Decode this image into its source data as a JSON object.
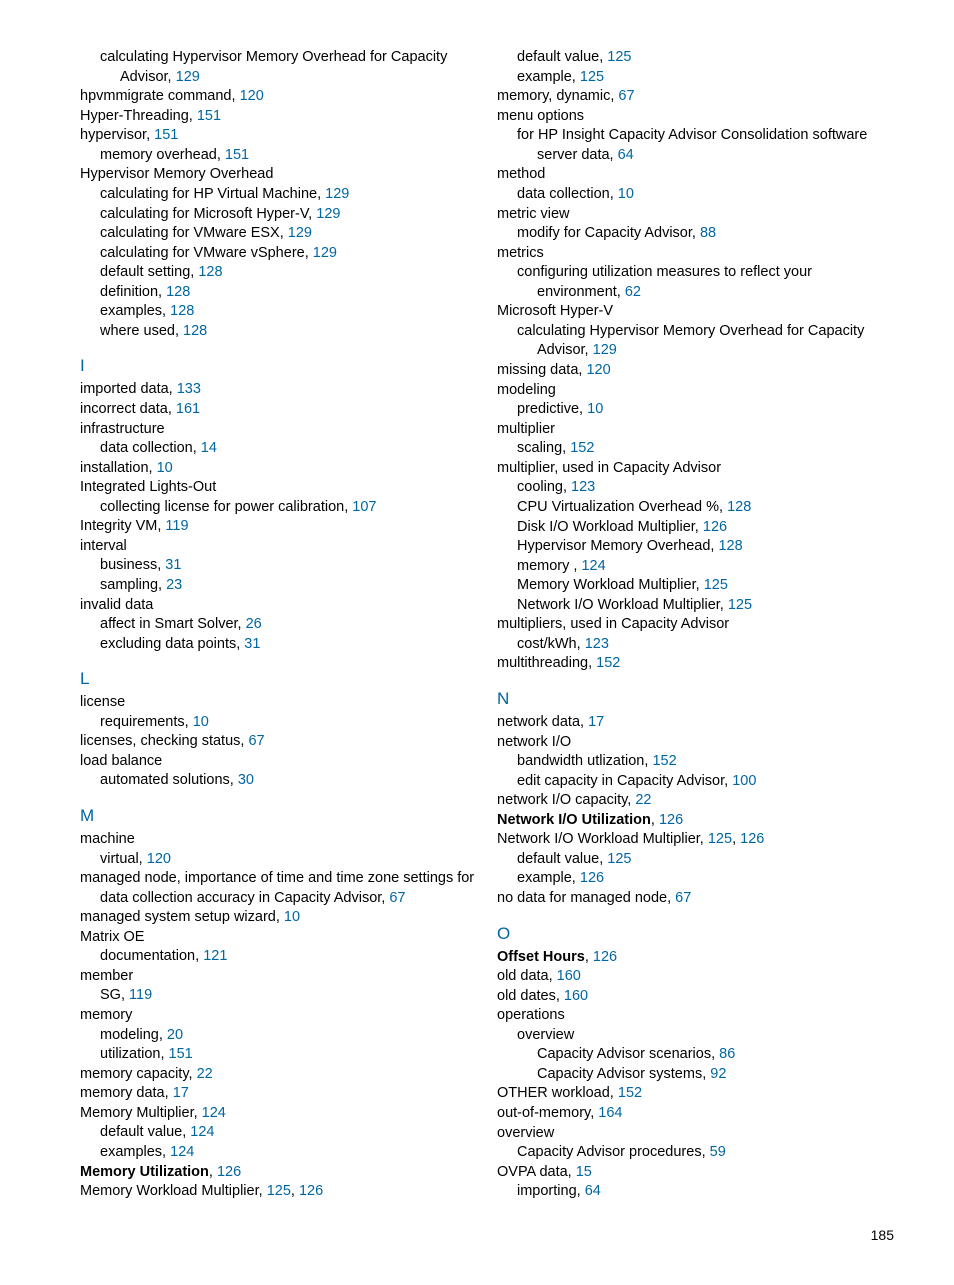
{
  "page_number": "185",
  "columns": [
    {
      "entries": [
        {
          "lvl": 2,
          "text": "calculating Hypervisor Memory Overhead for Capacity Advisor,",
          "pages": [
            "129"
          ]
        },
        {
          "lvl": 1,
          "text": "hpvmmigrate command,",
          "pages": [
            "120"
          ]
        },
        {
          "lvl": 1,
          "text": "Hyper-Threading,",
          "pages": [
            "151"
          ]
        },
        {
          "lvl": 1,
          "text": "hypervisor,",
          "pages": [
            "151"
          ]
        },
        {
          "lvl": 2,
          "text": "memory overhead,",
          "pages": [
            "151"
          ]
        },
        {
          "lvl": 1,
          "text": "Hypervisor Memory Overhead"
        },
        {
          "lvl": 2,
          "text": "calculating for HP Virtual Machine,",
          "pages": [
            "129"
          ]
        },
        {
          "lvl": 2,
          "text": "calculating for Microsoft Hyper-V,",
          "pages": [
            "129"
          ]
        },
        {
          "lvl": 2,
          "text": "calculating for VMware ESX,",
          "pages": [
            "129"
          ]
        },
        {
          "lvl": 2,
          "text": "calculating for VMware vSphere,",
          "pages": [
            "129"
          ]
        },
        {
          "lvl": 2,
          "text": "default setting,",
          "pages": [
            "128"
          ]
        },
        {
          "lvl": 2,
          "text": "definition,",
          "pages": [
            "128"
          ]
        },
        {
          "lvl": 2,
          "text": "examples,",
          "pages": [
            "128"
          ]
        },
        {
          "lvl": 2,
          "text": "where used,",
          "pages": [
            "128"
          ]
        },
        {
          "head": "I"
        },
        {
          "lvl": 1,
          "text": "imported data,",
          "pages": [
            "133"
          ]
        },
        {
          "lvl": 1,
          "text": "incorrect data,",
          "pages": [
            "161"
          ]
        },
        {
          "lvl": 1,
          "text": "infrastructure"
        },
        {
          "lvl": 2,
          "text": "data collection,",
          "pages": [
            "14"
          ]
        },
        {
          "lvl": 1,
          "text": "installation,",
          "pages": [
            "10"
          ]
        },
        {
          "lvl": 1,
          "text": "Integrated Lights-Out"
        },
        {
          "lvl": 2,
          "text": "collecting license for power calibration,",
          "pages": [
            "107"
          ]
        },
        {
          "lvl": 1,
          "text": "Integrity VM,",
          "pages": [
            "119"
          ]
        },
        {
          "lvl": 1,
          "text": "interval"
        },
        {
          "lvl": 2,
          "text": "business,",
          "pages": [
            "31"
          ]
        },
        {
          "lvl": 2,
          "text": "sampling,",
          "pages": [
            "23"
          ]
        },
        {
          "lvl": 1,
          "text": "invalid data"
        },
        {
          "lvl": 2,
          "text": "affect in Smart Solver,",
          "pages": [
            "26"
          ]
        },
        {
          "lvl": 2,
          "text": "excluding data points,",
          "pages": [
            "31"
          ]
        },
        {
          "head": "L"
        },
        {
          "lvl": 1,
          "text": "license"
        },
        {
          "lvl": 2,
          "text": "requirements,",
          "pages": [
            "10"
          ]
        },
        {
          "lvl": 1,
          "text": "licenses, checking status,",
          "pages": [
            "67"
          ]
        },
        {
          "lvl": 1,
          "text": "load balance"
        },
        {
          "lvl": 2,
          "text": "automated solutions,",
          "pages": [
            "30"
          ]
        },
        {
          "head": "M"
        },
        {
          "lvl": 1,
          "text": "machine"
        },
        {
          "lvl": 2,
          "text": "virtual,",
          "pages": [
            "120"
          ]
        },
        {
          "lvl": 1,
          "text": "managed node, importance of time and time zone settings for data collection accuracy in Capacity Advisor,",
          "pages": [
            "67"
          ]
        },
        {
          "lvl": 1,
          "text": "managed system setup wizard,",
          "pages": [
            "10"
          ]
        },
        {
          "lvl": 1,
          "text": "Matrix OE"
        },
        {
          "lvl": 2,
          "text": "documentation,",
          "pages": [
            "121"
          ]
        },
        {
          "lvl": 1,
          "text": "member"
        },
        {
          "lvl": 2,
          "text": "SG,",
          "pages": [
            "119"
          ]
        },
        {
          "lvl": 1,
          "text": "memory"
        },
        {
          "lvl": 2,
          "text": "modeling,",
          "pages": [
            "20"
          ]
        },
        {
          "lvl": 2,
          "text": "utilization,",
          "pages": [
            "151"
          ]
        },
        {
          "lvl": 1,
          "text": "memory capacity,",
          "pages": [
            "22"
          ]
        },
        {
          "lvl": 1,
          "text": "memory data,",
          "pages": [
            "17"
          ]
        },
        {
          "lvl": 1,
          "text": "Memory Multiplier,",
          "pages": [
            "124"
          ]
        },
        {
          "lvl": 2,
          "text": "default value,",
          "pages": [
            "124"
          ]
        },
        {
          "lvl": 2,
          "text": "examples,",
          "pages": [
            "124"
          ]
        },
        {
          "lvl": 1,
          "bold": true,
          "text": "Memory Utilization",
          "after": ",",
          "pages": [
            "126"
          ]
        },
        {
          "lvl": 1,
          "text": "Memory Workload Multiplier,",
          "pages": [
            "125",
            "126"
          ]
        }
      ]
    },
    {
      "entries": [
        {
          "lvl": 2,
          "text": "default value,",
          "pages": [
            "125"
          ]
        },
        {
          "lvl": 2,
          "text": "example,",
          "pages": [
            "125"
          ]
        },
        {
          "lvl": 1,
          "text": "memory, dynamic,",
          "pages": [
            "67"
          ]
        },
        {
          "lvl": 1,
          "text": "menu options"
        },
        {
          "lvl": 2,
          "text": "for HP Insight Capacity Advisor Consolidation software server data,",
          "pages": [
            "64"
          ]
        },
        {
          "lvl": 1,
          "text": "method"
        },
        {
          "lvl": 2,
          "text": "data collection,",
          "pages": [
            "10"
          ]
        },
        {
          "lvl": 1,
          "text": "metric view"
        },
        {
          "lvl": 2,
          "text": "modify for Capacity Advisor,",
          "pages": [
            "88"
          ]
        },
        {
          "lvl": 1,
          "text": "metrics"
        },
        {
          "lvl": 2,
          "text": "configuring utilization measures to reflect your environment,",
          "pages": [
            "62"
          ]
        },
        {
          "lvl": 1,
          "text": "Microsoft Hyper-V"
        },
        {
          "lvl": 2,
          "text": "calculating Hypervisor Memory Overhead for Capacity Advisor,",
          "pages": [
            "129"
          ]
        },
        {
          "lvl": 1,
          "text": "missing data,",
          "pages": [
            "120"
          ]
        },
        {
          "lvl": 1,
          "text": "modeling"
        },
        {
          "lvl": 2,
          "text": "predictive,",
          "pages": [
            "10"
          ]
        },
        {
          "lvl": 1,
          "text": "multiplier"
        },
        {
          "lvl": 2,
          "text": "scaling,",
          "pages": [
            "152"
          ]
        },
        {
          "lvl": 1,
          "text": "multiplier, used in Capacity Advisor"
        },
        {
          "lvl": 2,
          "text": "cooling,",
          "pages": [
            "123"
          ]
        },
        {
          "lvl": 2,
          "text": "CPU Virtualization Overhead %,",
          "pages": [
            "128"
          ]
        },
        {
          "lvl": 2,
          "text": "Disk I/O Workload Multiplier,",
          "pages": [
            "126"
          ]
        },
        {
          "lvl": 2,
          "text": "Hypervisor Memory Overhead,",
          "pages": [
            "128"
          ]
        },
        {
          "lvl": 2,
          "text": "memory ,",
          "pages": [
            "124"
          ]
        },
        {
          "lvl": 2,
          "text": "Memory Workload Multiplier,",
          "pages": [
            "125"
          ]
        },
        {
          "lvl": 2,
          "text": "Network I/O Workload Multiplier,",
          "pages": [
            "125"
          ]
        },
        {
          "lvl": 1,
          "text": "multipliers, used in Capacity Advisor"
        },
        {
          "lvl": 2,
          "text": "cost/kWh,",
          "pages": [
            "123"
          ]
        },
        {
          "lvl": 1,
          "text": "multithreading,",
          "pages": [
            "152"
          ]
        },
        {
          "head": "N"
        },
        {
          "lvl": 1,
          "text": "network data,",
          "pages": [
            "17"
          ]
        },
        {
          "lvl": 1,
          "text": "network I/O"
        },
        {
          "lvl": 2,
          "text": "bandwidth utlization,",
          "pages": [
            "152"
          ]
        },
        {
          "lvl": 2,
          "text": "edit capacity in Capacity Advisor,",
          "pages": [
            "100"
          ]
        },
        {
          "lvl": 1,
          "text": "network I/O capacity,",
          "pages": [
            "22"
          ]
        },
        {
          "lvl": 1,
          "bold": true,
          "text": "Network I/O Utilization",
          "after": ",",
          "pages": [
            "126"
          ]
        },
        {
          "lvl": 1,
          "text": "Network I/O Workload Multiplier,",
          "pages": [
            "125",
            "126"
          ]
        },
        {
          "lvl": 2,
          "text": "default value,",
          "pages": [
            "125"
          ]
        },
        {
          "lvl": 2,
          "text": "example,",
          "pages": [
            "126"
          ]
        },
        {
          "lvl": 1,
          "text": "no data for managed node,",
          "pages": [
            "67"
          ]
        },
        {
          "head": "O"
        },
        {
          "lvl": 1,
          "bold": true,
          "text": "Offset Hours",
          "after": ",",
          "pages": [
            "126"
          ]
        },
        {
          "lvl": 1,
          "text": "old data,",
          "pages": [
            "160"
          ]
        },
        {
          "lvl": 1,
          "text": "old dates,",
          "pages": [
            "160"
          ]
        },
        {
          "lvl": 1,
          "text": "operations"
        },
        {
          "lvl": 2,
          "text": "overview"
        },
        {
          "lvl": 3,
          "text": "Capacity Advisor scenarios,",
          "pages": [
            "86"
          ]
        },
        {
          "lvl": 3,
          "text": "Capacity Advisor systems,",
          "pages": [
            "92"
          ]
        },
        {
          "lvl": 1,
          "text": "OTHER workload,",
          "pages": [
            "152"
          ]
        },
        {
          "lvl": 1,
          "text": "out-of-memory,",
          "pages": [
            "164"
          ]
        },
        {
          "lvl": 1,
          "text": "overview"
        },
        {
          "lvl": 2,
          "text": "Capacity Advisor procedures,",
          "pages": [
            "59"
          ]
        },
        {
          "lvl": 1,
          "text": "OVPA data,",
          "pages": [
            "15"
          ]
        },
        {
          "lvl": 2,
          "text": "importing,",
          "pages": [
            "64"
          ]
        }
      ]
    }
  ]
}
